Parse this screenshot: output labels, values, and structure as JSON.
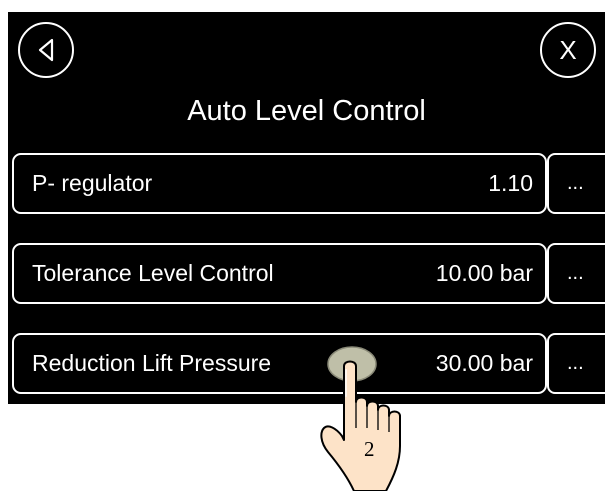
{
  "header": {
    "back_icon": "back-arrow-icon",
    "close_label": "X",
    "title": "Auto Level Control"
  },
  "rows": [
    {
      "label": "P- regulator",
      "value": "1.10",
      "more": "..."
    },
    {
      "label": "Tolerance Level Control",
      "value": "10.00 bar",
      "more": "..."
    },
    {
      "label": "Reduction Lift Pressure",
      "value": "30.00 bar",
      "more": "..."
    }
  ],
  "annotation": {
    "step_number": "2",
    "icon": "pointing-hand-icon"
  },
  "colors": {
    "screen_background": "#000000",
    "foreground": "#ffffff",
    "touch_highlight": "#bfbfa8",
    "skin": "#fde3c8"
  }
}
